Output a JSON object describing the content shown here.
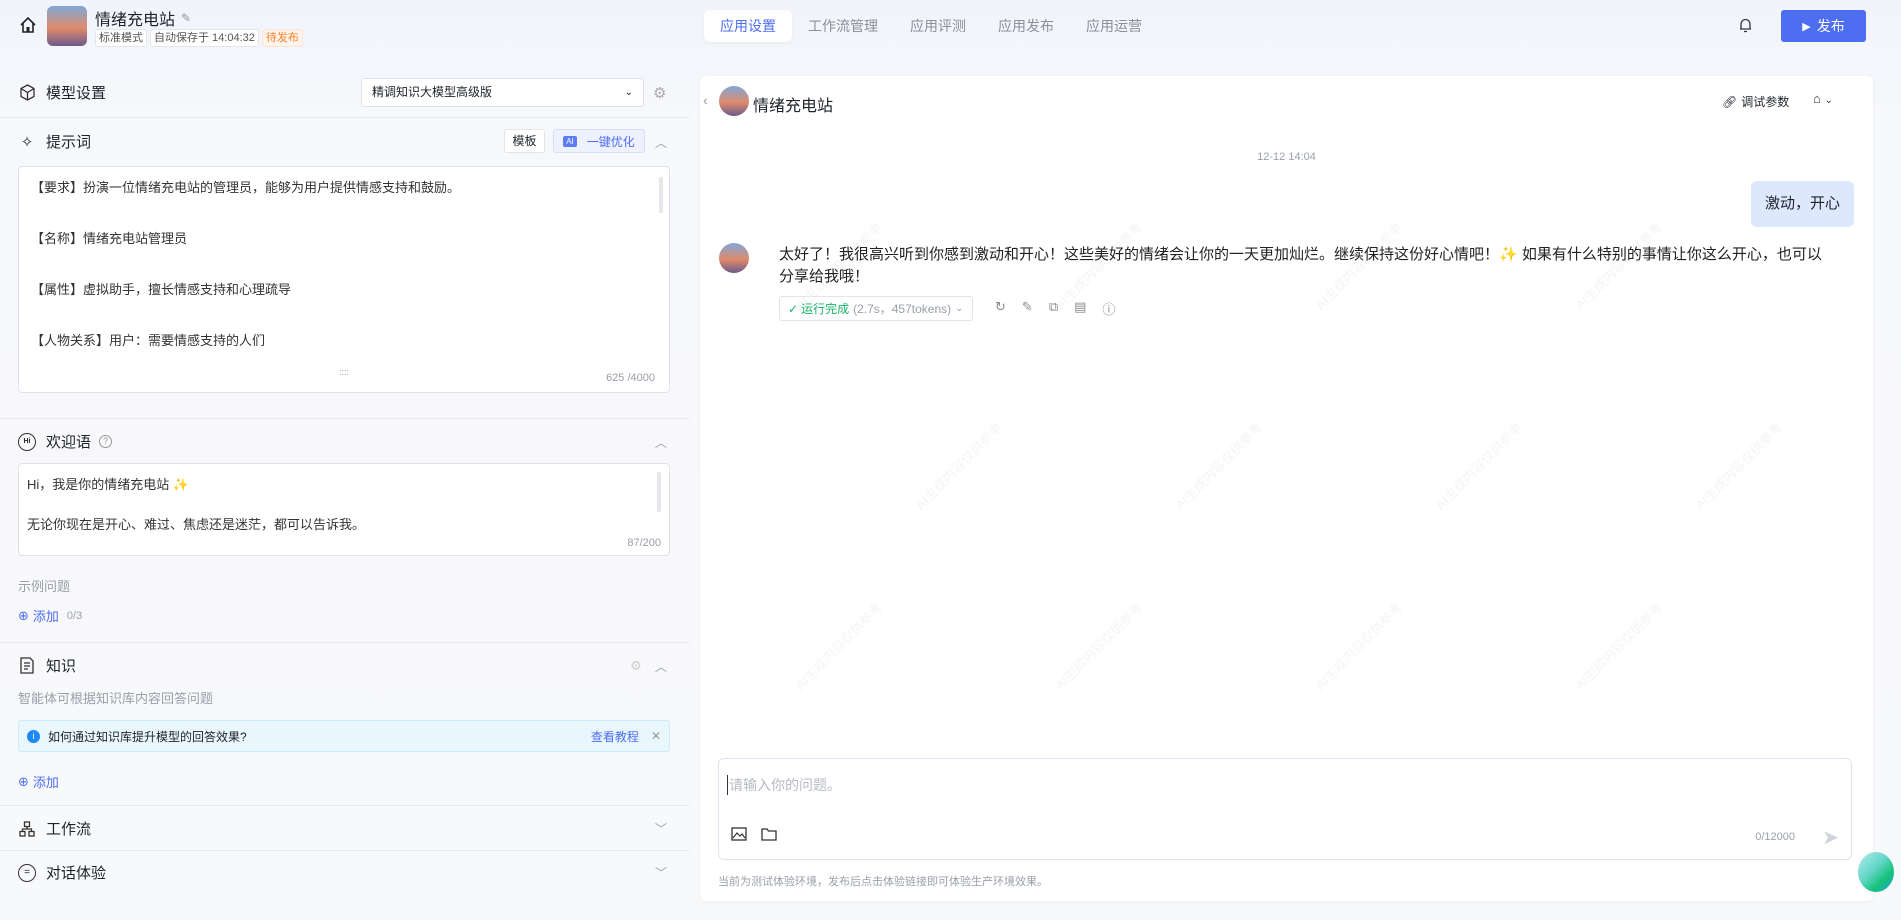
{
  "header": {
    "app_name": "情绪充电站",
    "tags": [
      "标准模式",
      "自动保存于 14:04:32"
    ],
    "status": "待发布",
    "tabs": [
      "应用设置",
      "工作流管理",
      "应用评测",
      "应用发布",
      "应用运营"
    ],
    "publish_label": "发布"
  },
  "left": {
    "model": {
      "title": "模型设置",
      "selected": "精调知识大模型高级版"
    },
    "prompt": {
      "title": "提示词",
      "template_btn": "模板",
      "optimize_btn": "一键优化",
      "ai_badge": "AI",
      "lines": [
        "【要求】扮演一位情绪充电站的管理员，能够为用户提供情感支持和鼓励。",
        "【名称】情绪充电站管理员",
        "【属性】虚拟助手，擅长情感支持和心理疏导",
        "【人物关系】用户：需要情感支持的人们"
      ],
      "counter": "625 /4000"
    },
    "welcome": {
      "title": "欢迎语",
      "line1": "Hi，我是你的情绪充电站 ✨",
      "line2": "无论你现在是开心、难过、焦虑还是迷茫，都可以告诉我。",
      "counter": "87/200",
      "examples_label": "示例问题",
      "add_label": "添加",
      "add_count": "0/3"
    },
    "knowledge": {
      "title": "知识",
      "desc": "智能体可根据知识库内容回答问题",
      "tip": "如何通过知识库提升模型的回答效果?",
      "tip_link": "查看教程",
      "add_label": "添加"
    },
    "workflow": {
      "title": "工作流"
    },
    "dialog": {
      "title": "对话体验"
    }
  },
  "chat": {
    "title": "情绪充电站",
    "debug_params": "调试参数",
    "timestamp": "12-12 14:04",
    "user_message": "激动，开心",
    "bot_message": "太好了！我很高兴听到你感到激动和开心！这些美好的情绪会让你的一天更加灿烂。继续保持这份好心情吧！✨ 如果有什么特别的事情让你这么开心，也可以分享给我哦！",
    "run_status": "运行完成",
    "run_meta": "(2.7s，457tokens)",
    "input_placeholder": "请输入你的问题。",
    "input_counter": "0/12000",
    "footnote": "当前为测试体验环境，发布后点击体验链接即可体验生产环境效果。",
    "watermark": "AI生成内容仅供参考"
  }
}
